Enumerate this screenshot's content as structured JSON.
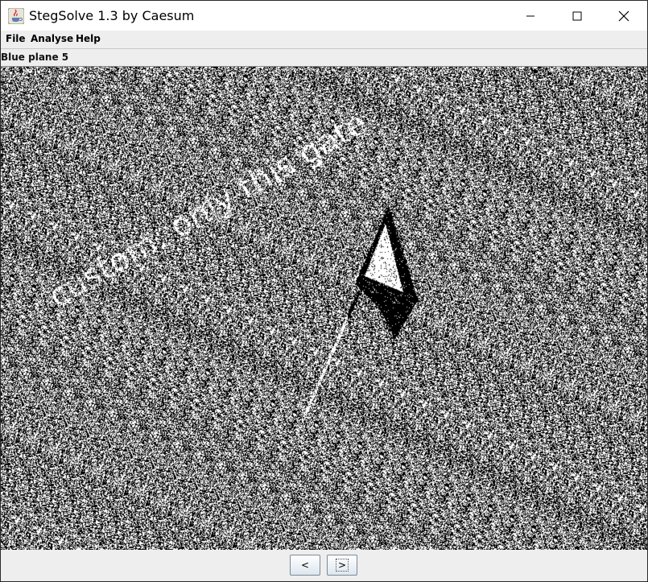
{
  "window": {
    "title": "StegSolve 1.3 by Caesum",
    "minimize_symbol": "—",
    "maximize_symbol": "☐",
    "close_symbol": "✕"
  },
  "menu": [
    "File",
    "Analyse",
    "Help"
  ],
  "status": {
    "plane_label": "Blue plane 5"
  },
  "image": {
    "hidden_text": "custom: only this gate",
    "foreground": "#ffffff",
    "background": "#000000"
  },
  "nav": {
    "prev_label": "<",
    "next_label": ">"
  },
  "icons": {
    "app": "java-coffee-icon",
    "minimize": "minimize-icon",
    "maximize": "maximize-icon",
    "close": "close-icon"
  }
}
